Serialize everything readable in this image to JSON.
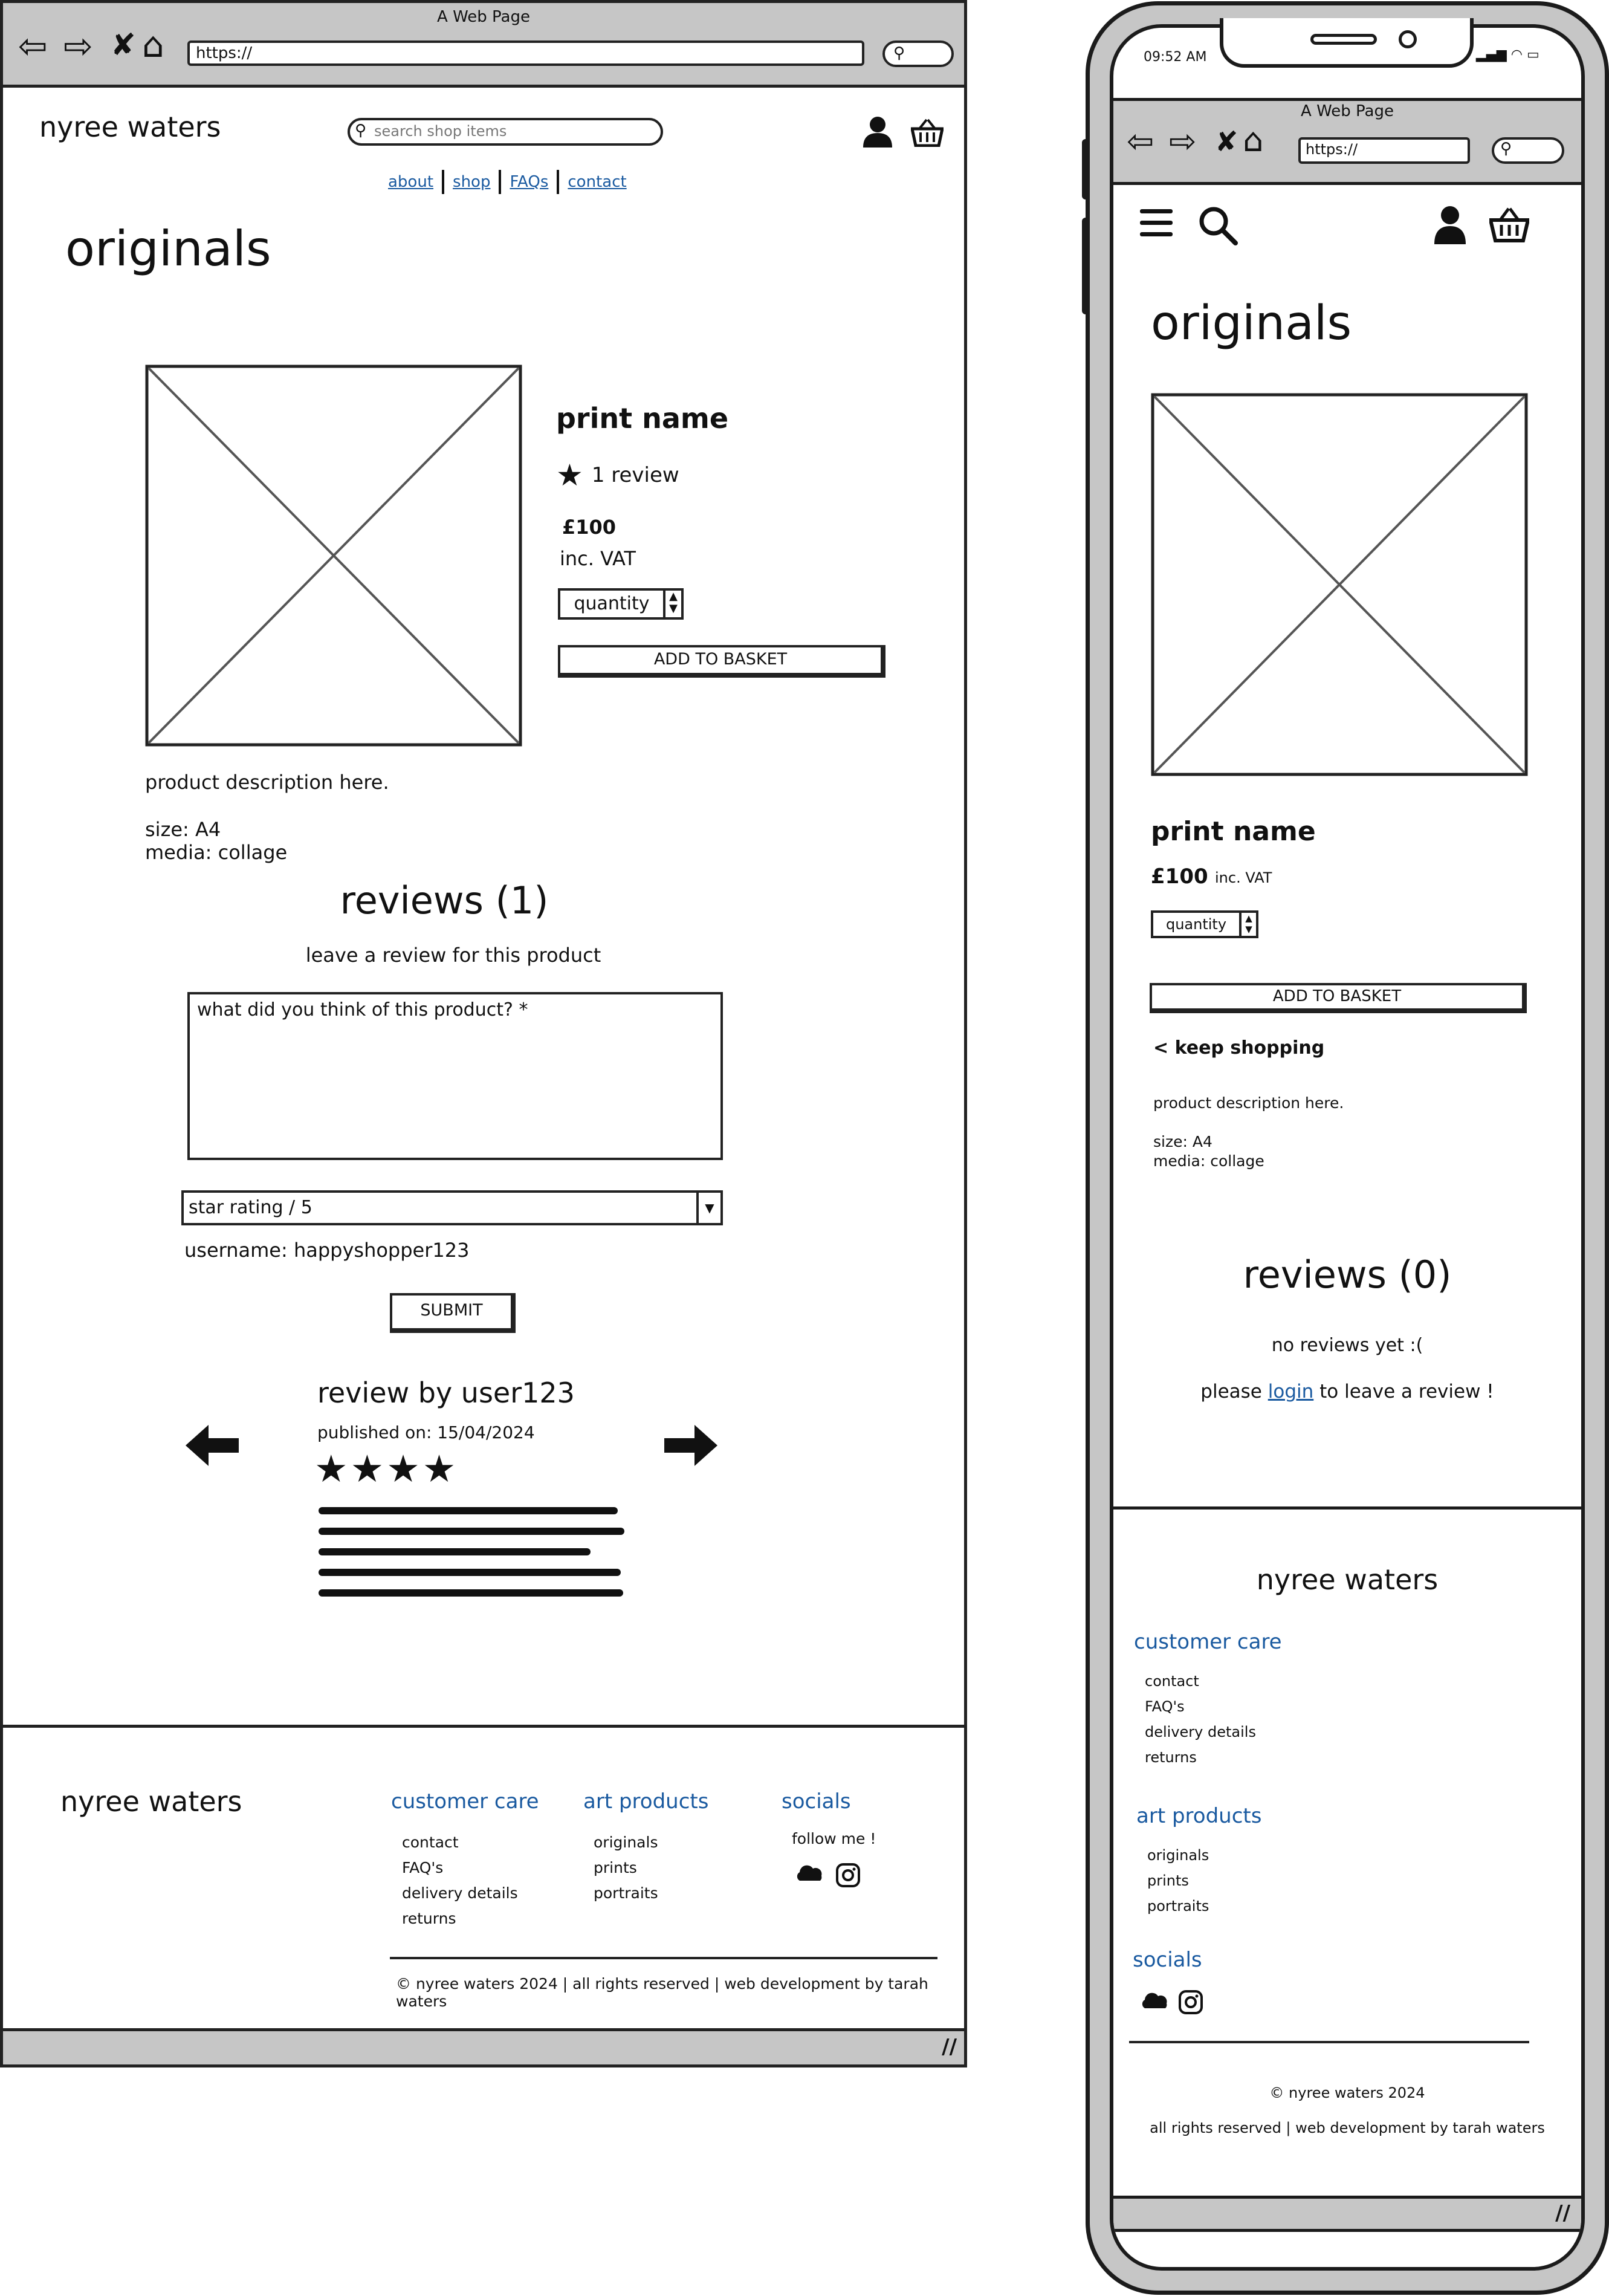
{
  "browser": {
    "title": "A Web Page",
    "url": "https://"
  },
  "header": {
    "brand": "nyree waters",
    "search_placeholder": "search shop items",
    "nav": [
      "about",
      "shop",
      "FAQs",
      "contact"
    ]
  },
  "page": {
    "heading": "originals",
    "product": {
      "name": "print name",
      "review_count_label": "1 review",
      "price": "£100",
      "vat": "inc. VAT",
      "quantity_label": "quantity",
      "add_to_basket": "ADD TO BASKET",
      "description": "product description here.",
      "size": "size: A4",
      "media": "media: collage"
    },
    "reviews": {
      "heading": "reviews (1)",
      "leave_prompt": "leave a review for this product",
      "textarea_placeholder": "what did you think of this product? *",
      "rating_select": "star rating / 5",
      "username": "username: happyshopper123",
      "submit": "SUBMIT",
      "card": {
        "title": "review by user123",
        "published": "published on: 15/04/2024",
        "stars": 4
      }
    }
  },
  "footer": {
    "brand": "nyree waters",
    "customer_care": {
      "heading": "customer care",
      "items": [
        "contact",
        "FAQ's",
        "delivery details",
        "returns"
      ]
    },
    "art_products": {
      "heading": "art products",
      "items": [
        "originals",
        "prints",
        "portraits"
      ]
    },
    "socials": {
      "heading": "socials",
      "follow": "follow me !"
    },
    "copyright": "© nyree waters 2024 | all rights reserved | web development by tarah waters"
  },
  "mobile": {
    "status_time": "09:52 AM",
    "browser_title": "A Web Page",
    "url": "https://",
    "heading": "originals",
    "product_name": "print name",
    "price": "£100",
    "vat": "inc. VAT",
    "quantity_label": "quantity",
    "add_to_basket": "ADD TO BASKET",
    "keep_shopping": "< keep shopping",
    "description": "product description here.",
    "size": "size: A4",
    "media": "media: collage",
    "reviews_heading": "reviews (0)",
    "no_reviews": "no reviews yet :(",
    "login_prefix": "please",
    "login_link": "login",
    "login_suffix": "to leave a review !",
    "footer_brand": "nyree waters",
    "customer_care_heading": "customer care",
    "customer_care_items": [
      "contact",
      "FAQ's",
      "delivery details",
      "returns"
    ],
    "art_products_heading": "art products",
    "art_products_items": [
      "originals",
      "prints",
      "portraits"
    ],
    "socials_heading": "socials",
    "copyright": "© nyree waters 2024",
    "rights": "all rights reserved | web development by tarah waters"
  },
  "colors": {
    "link": "#1a5aa0",
    "chrome_gray": "#c6c6c6",
    "ink": "#111111"
  }
}
